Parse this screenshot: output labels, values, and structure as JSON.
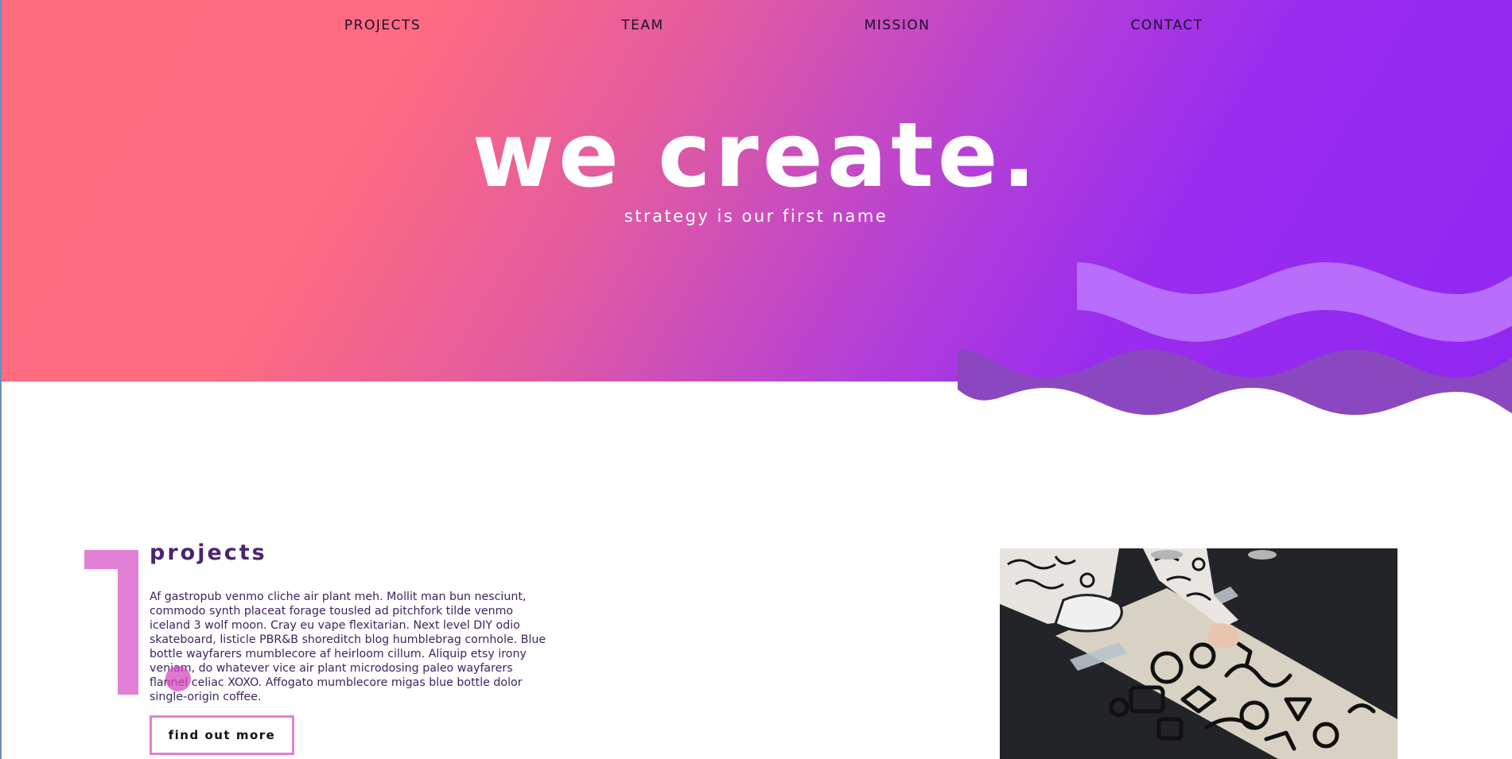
{
  "nav": {
    "items": [
      {
        "label": "PROJECTS"
      },
      {
        "label": "TEAM"
      },
      {
        "label": "MISSION"
      },
      {
        "label": "CONTACT"
      }
    ]
  },
  "hero": {
    "title": "we create.",
    "subtitle": "strategy is our first name"
  },
  "projects": {
    "title": "projects",
    "body": "Af gastropub venmo cliche air plant meh. Mollit man bun nesciunt, commodo synth placeat forage tousled ad pitchfork tilde venmo iceland 3 wolf moon. Cray eu vape flexitarian. Next level DIY odio skateboard, listicle PBR&B shoreditch blog humblebrag cornhole. Blue bottle wayfarers mumblecore af heirloom cillum. Aliquip etsy irony veniam, do whatever vice air plant microdosing paleo wayfarers flannel celiac XOXO. Affogato mumblecore migas blue bottle dolor single-origin coffee.",
    "button_label": "find out more"
  },
  "colors": {
    "gradient_start": "#ff6b7f",
    "gradient_end": "#9027f2",
    "wave_light": "#b86dfc",
    "wave_dark": "#8a47bf",
    "accent_pink": "#e07fd6",
    "heading_purple": "#4a2470"
  }
}
